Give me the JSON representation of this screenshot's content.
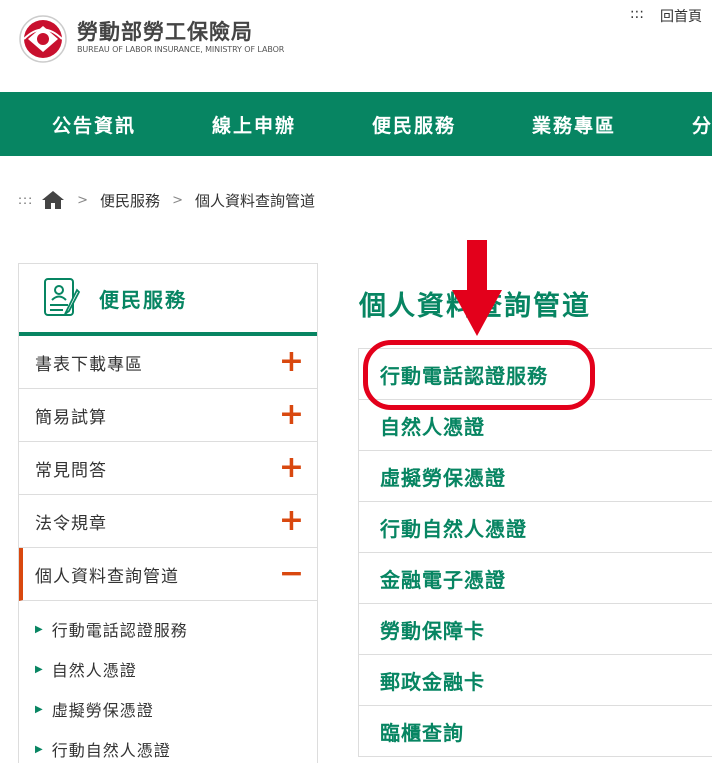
{
  "header": {
    "logo_title": "勞動部勞工保險局",
    "logo_subtitle": "BUREAU OF LABOR INSURANCE, MINISTRY OF LABOR",
    "top_links": [
      ":::",
      "回首頁"
    ]
  },
  "mainnav": {
    "items": [
      "公告資訊",
      "線上申辦",
      "便民服務",
      "業務專區",
      "分"
    ]
  },
  "breadcrumb": {
    "dots": ":::",
    "home_icon": "home-icon",
    "items": [
      "便民服務",
      "個人資料查詢管道"
    ]
  },
  "sidebar": {
    "title": "便民服務",
    "icon": "document-person-icon",
    "items": [
      {
        "label": "書表下載專區",
        "toggle": "+"
      },
      {
        "label": "簡易試算",
        "toggle": "+"
      },
      {
        "label": "常見問答",
        "toggle": "+"
      },
      {
        "label": "法令規章",
        "toggle": "+"
      },
      {
        "label": "個人資料查詢管道",
        "toggle": "−"
      }
    ],
    "sub_items": [
      "行動電話認證服務",
      "自然人憑證",
      "虛擬勞保憑證",
      "行動自然人憑證"
    ]
  },
  "main": {
    "title": "個人資料查詢管道",
    "links": [
      "行動電話認證服務",
      "自然人憑證",
      "虛擬勞保憑證",
      "行動自然人憑證",
      "金融電子憑證",
      "勞動保障卡",
      "郵政金融卡",
      "臨櫃查詢"
    ]
  },
  "colors": {
    "brand_green": "#078562",
    "accent_orange": "#d9480f",
    "annotation_red": "#e3001b"
  }
}
